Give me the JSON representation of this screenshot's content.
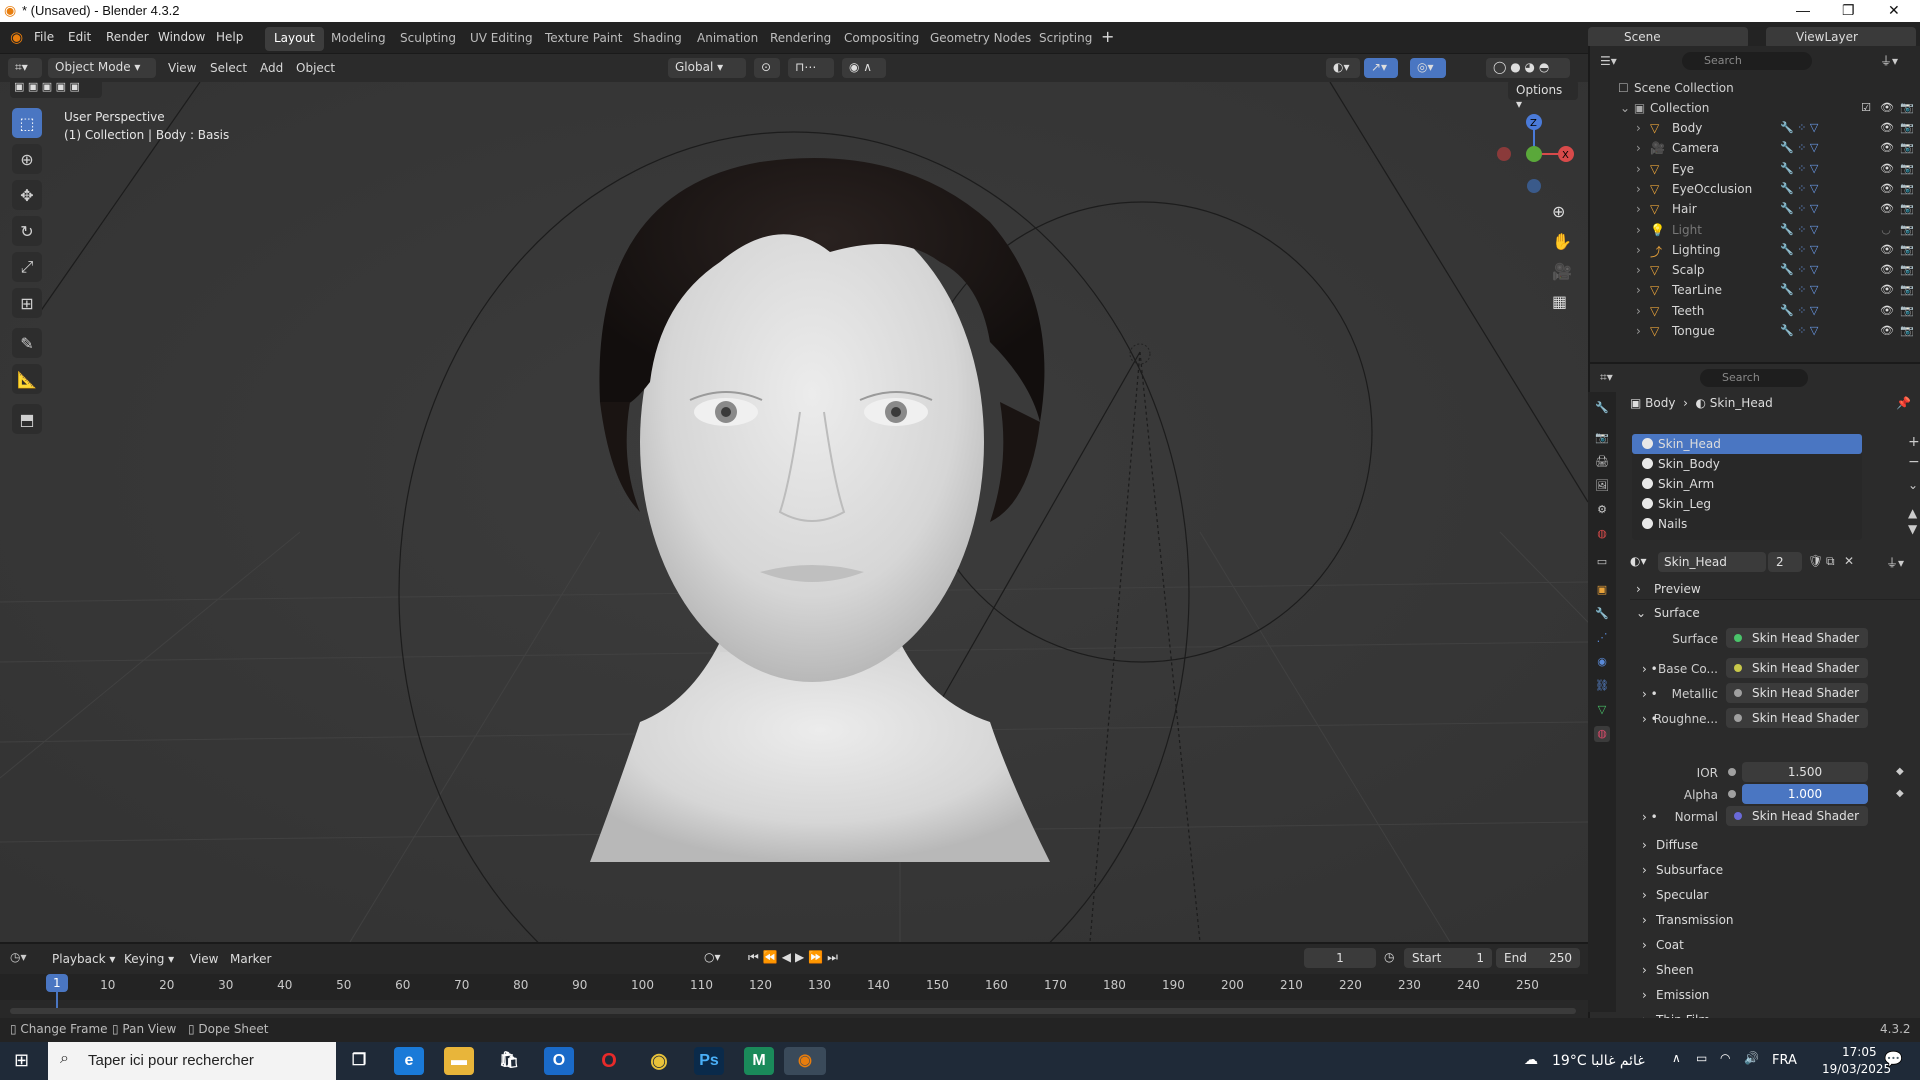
{
  "window": {
    "title": "* (Unsaved) - Blender 4.3.2"
  },
  "menu": [
    "File",
    "Edit",
    "Render",
    "Window",
    "Help"
  ],
  "workspaces": [
    "Layout",
    "Modeling",
    "Sculpting",
    "UV Editing",
    "Texture Paint",
    "Shading",
    "Animation",
    "Rendering",
    "Compositing",
    "Geometry Nodes",
    "Scripting"
  ],
  "topright": {
    "scene": "Scene",
    "viewlayer": "ViewLayer"
  },
  "header": {
    "mode": "Object Mode",
    "view": "View",
    "select": "Select",
    "add": "Add",
    "object": "Object",
    "orientation": "Global",
    "options": "Options"
  },
  "viewport": {
    "perspective": "User Perspective",
    "collection_info": "(1) Collection | Body : Basis"
  },
  "outliner": {
    "search_placeholder": "Search",
    "scene_collection": "Scene Collection",
    "collection": "Collection",
    "items": [
      "Body",
      "Camera",
      "Eye",
      "EyeOcclusion",
      "Hair",
      "Light",
      "Lighting",
      "Scalp",
      "TearLine",
      "Teeth",
      "Tongue"
    ]
  },
  "properties": {
    "search_placeholder": "Search",
    "breadcrumb": {
      "object": "Body",
      "material": "Skin_Head"
    },
    "materials": [
      "Skin_Head",
      "Skin_Body",
      "Skin_Arm",
      "Skin_Leg",
      "Nails"
    ],
    "active_material": "Skin_Head",
    "user_count": "2",
    "preview": "Preview",
    "surface_section": "Surface",
    "surface": {
      "label": "Surface",
      "value": "Skin Head Shader"
    },
    "inputs": [
      {
        "label": "Base Co...",
        "value": "Skin Head Shader",
        "color": "#c8c84a"
      },
      {
        "label": "Metallic",
        "value": "Skin Head Shader",
        "color": "#a0a0a0"
      },
      {
        "label": "Roughne...",
        "value": "Skin Head Shader",
        "color": "#a0a0a0"
      }
    ],
    "ior": {
      "label": "IOR",
      "value": "1.500"
    },
    "alpha": {
      "label": "Alpha",
      "value": "1.000"
    },
    "normal": {
      "label": "Normal",
      "value": "Skin Head Shader"
    },
    "subsections": [
      "Diffuse",
      "Subsurface",
      "Specular",
      "Transmission",
      "Coat",
      "Sheen",
      "Emission",
      "Thin Film"
    ]
  },
  "timeline": {
    "playback": "Playback",
    "keying": "Keying",
    "view": "View",
    "marker": "Marker",
    "current_frame": "1",
    "start_label": "Start",
    "start": "1",
    "end_label": "End",
    "end": "250",
    "ruler": [
      "1",
      "10",
      "20",
      "30",
      "40",
      "50",
      "60",
      "70",
      "80",
      "90",
      "100",
      "110",
      "120",
      "130",
      "140",
      "150",
      "160",
      "170",
      "180",
      "190",
      "200",
      "210",
      "220",
      "230",
      "240",
      "250"
    ]
  },
  "statusbar": {
    "change_frame": "Change Frame",
    "pan_view": "Pan View",
    "dope_sheet": "Dope Sheet",
    "version": "4.3.2"
  },
  "taskbar": {
    "search": "Taper ici pour rechercher",
    "weather": "19°C غائم غالبا",
    "lang": "FRA",
    "time": "17:05",
    "date": "19/03/2025"
  },
  "colors": {
    "accent": "#4a76c2",
    "viewport_bg": "#3a3a3a",
    "panel": "#2b2b2b"
  }
}
